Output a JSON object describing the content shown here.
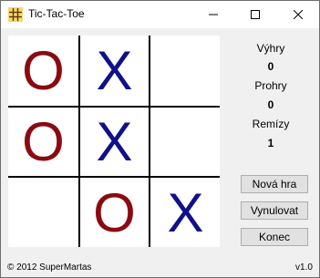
{
  "window": {
    "title": "Tic-Tac-Toe"
  },
  "board": {
    "cells": [
      {
        "mark": "O",
        "player": "o"
      },
      {
        "mark": "X",
        "player": "x"
      },
      {
        "mark": "",
        "player": "empty"
      },
      {
        "mark": "O",
        "player": "o"
      },
      {
        "mark": "X",
        "player": "x"
      },
      {
        "mark": "",
        "player": "empty"
      },
      {
        "mark": "",
        "player": "empty"
      },
      {
        "mark": "O",
        "player": "o"
      },
      {
        "mark": "X",
        "player": "x"
      }
    ],
    "o_color": "#8b0a12",
    "x_color": "#10108a"
  },
  "stats": {
    "wins_label": "Výhry",
    "wins_value": "0",
    "losses_label": "Prohry",
    "losses_value": "0",
    "draws_label": "Remízy",
    "draws_value": "1"
  },
  "buttons": {
    "new_game": "Nová hra",
    "reset": "Vynulovat",
    "quit": "Konec"
  },
  "footer": {
    "copyright": "© 2012 SuperMartas",
    "version": "v1.0"
  }
}
